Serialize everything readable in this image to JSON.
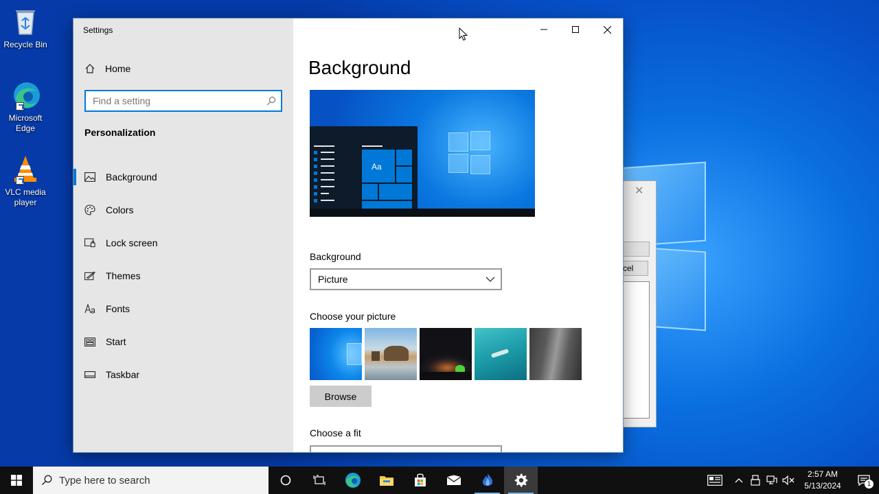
{
  "desktop": {
    "icons": [
      {
        "label": "Recycle Bin"
      },
      {
        "label": "Microsoft Edge"
      },
      {
        "label": "VLC media player"
      }
    ]
  },
  "background_dialog": {
    "partial_button_text": "cel"
  },
  "window": {
    "title": "Settings"
  },
  "sidebar": {
    "home_label": "Home",
    "search_placeholder": "Find a setting",
    "section_heading": "Personalization",
    "items": [
      {
        "label": "Background",
        "icon": "picture-icon",
        "active": true
      },
      {
        "label": "Colors",
        "icon": "palette-icon"
      },
      {
        "label": "Lock screen",
        "icon": "lock-screen-icon"
      },
      {
        "label": "Themes",
        "icon": "themes-icon"
      },
      {
        "label": "Fonts",
        "icon": "fonts-icon"
      },
      {
        "label": "Start",
        "icon": "start-icon"
      },
      {
        "label": "Taskbar",
        "icon": "taskbar-icon"
      }
    ]
  },
  "main": {
    "title": "Background",
    "preview": {
      "tile_text": "Aa"
    },
    "background_label": "Background",
    "background_value": "Picture",
    "choose_picture_label": "Choose your picture",
    "pictures": [
      "windows-blue-wallpaper",
      "beach-rocks-wallpaper",
      "night-sky-wallpaper",
      "underwater-swimmer-wallpaper",
      "rock-cliff-wallpaper"
    ],
    "browse_label": "Browse",
    "choose_fit_label": "Choose a fit"
  },
  "taskbar": {
    "search_placeholder": "Type here to search",
    "clock_time": "2:57 AM",
    "clock_date": "5/13/2024",
    "notification_count": "1"
  },
  "colors": {
    "accent": "#0078d7",
    "sidebar_bg": "#e6e6e6",
    "taskbar_bg": "#101010"
  }
}
